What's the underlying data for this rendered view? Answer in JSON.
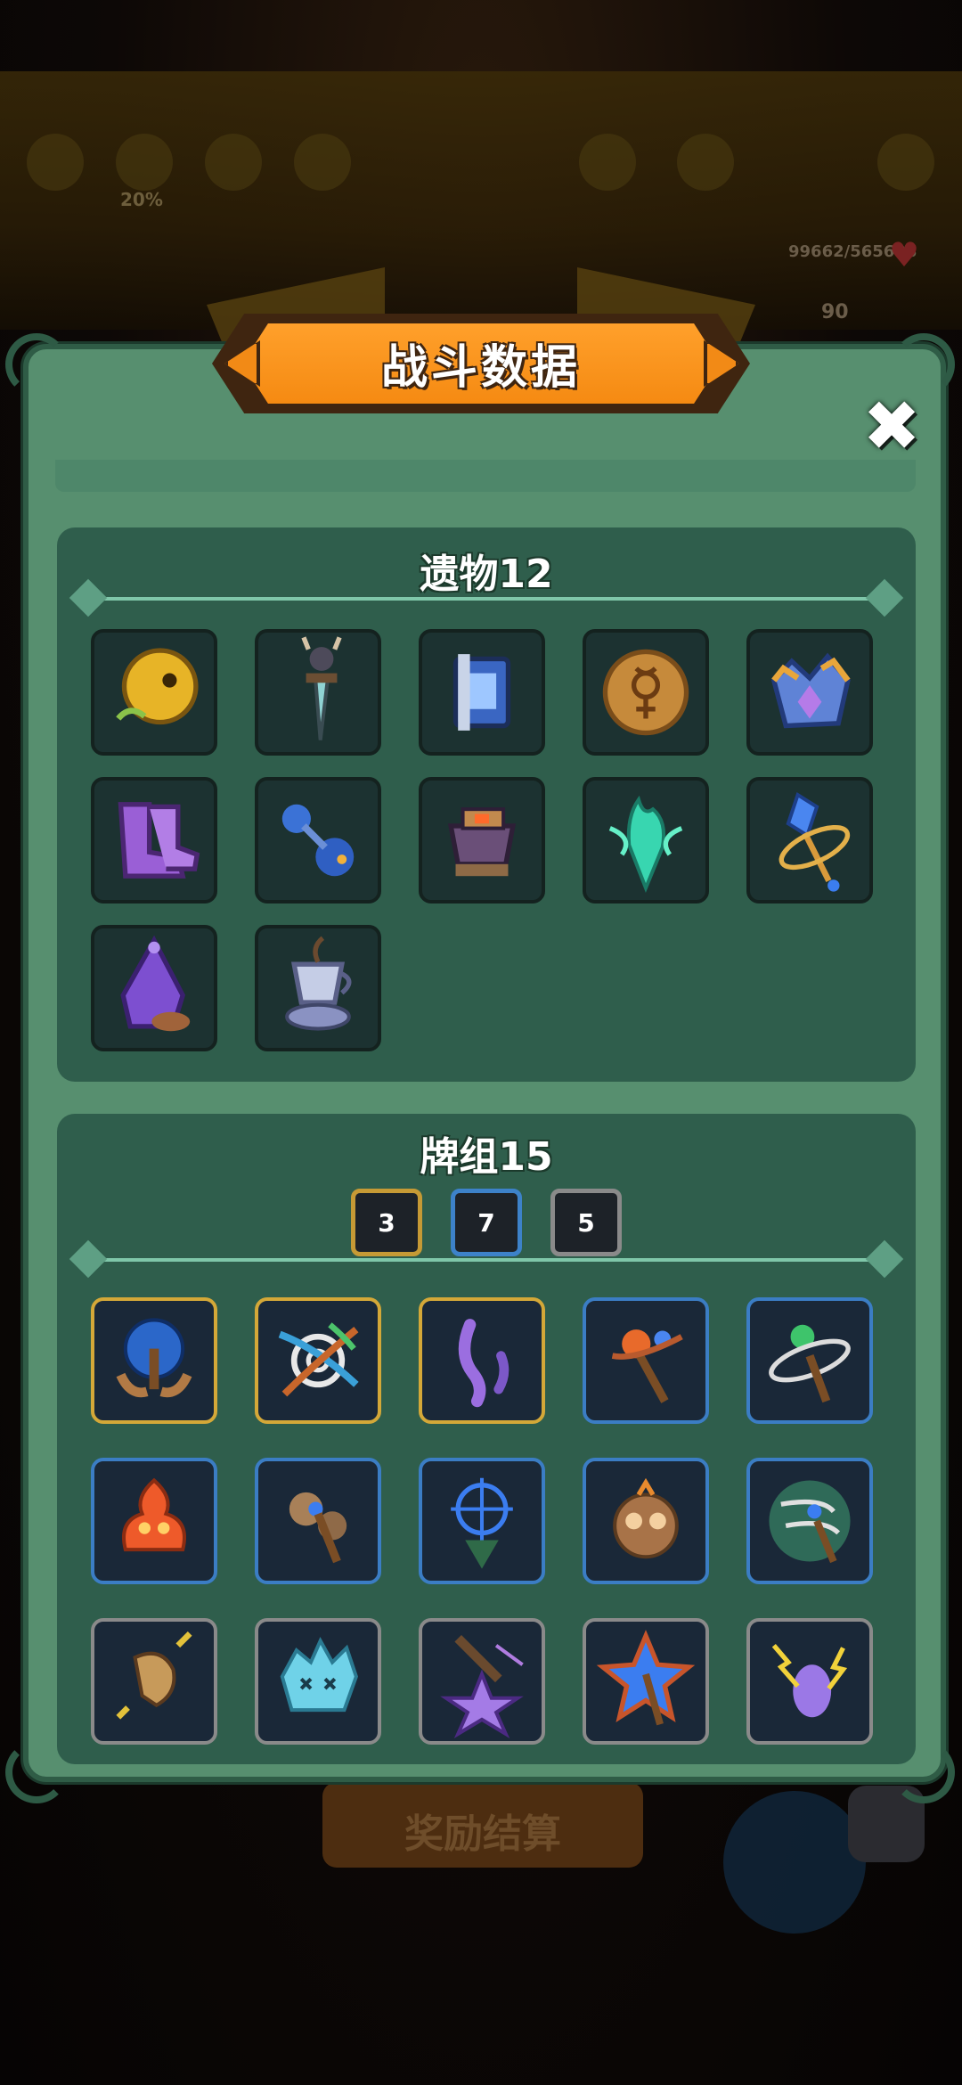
{
  "dialog": {
    "title": "战斗数据",
    "close_icon": "close-icon",
    "colors": {
      "panel": "#578f6f",
      "section": "#2f5e4c",
      "banner": "#f58a12"
    }
  },
  "background": {
    "damage_pct": "20%",
    "hp": "99662/565688",
    "gold": "90",
    "claim_button": "奖励结算"
  },
  "relics": {
    "title": "遗物12",
    "items": [
      "gold-orb-relic-icon",
      "horned-dagger-relic-icon",
      "blue-spellbook-relic-icon",
      "mercury-coin-relic-icon",
      "crowned-crystal-relic-icon",
      "purple-boots-relic-icon",
      "blue-dumbbell-relic-icon",
      "anvil-relic-icon",
      "green-flame-relic-icon",
      "crystal-orbit-relic-icon",
      "purple-shell-relic-icon",
      "teacup-relic-icon"
    ]
  },
  "deck": {
    "title": "牌组15",
    "counts": {
      "gold": "3",
      "blue": "7",
      "gray": "5"
    },
    "cards": [
      {
        "icon": "orb-hands-card-icon",
        "rarity": "gold"
      },
      {
        "icon": "vortex-slash-card-icon",
        "rarity": "gold"
      },
      {
        "icon": "purple-wisp-card-icon",
        "rarity": "gold"
      },
      {
        "icon": "fire-staff-card-icon",
        "rarity": "blue"
      },
      {
        "icon": "orbit-staff-card-icon",
        "rarity": "blue"
      },
      {
        "icon": "fire-spirit-card-icon",
        "rarity": "blue"
      },
      {
        "icon": "dust-torch-card-icon",
        "rarity": "blue"
      },
      {
        "icon": "target-staff-card-icon",
        "rarity": "blue"
      },
      {
        "icon": "dust-owl-card-icon",
        "rarity": "blue"
      },
      {
        "icon": "whirlwind-staff-card-icon",
        "rarity": "blue"
      },
      {
        "icon": "fist-card-icon",
        "rarity": "gray"
      },
      {
        "icon": "ice-skull-card-icon",
        "rarity": "gray"
      },
      {
        "icon": "star-strike-card-icon",
        "rarity": "gray"
      },
      {
        "icon": "star-staff-card-icon",
        "rarity": "gray"
      },
      {
        "icon": "lightning-wisp-card-icon",
        "rarity": "gray"
      }
    ]
  }
}
